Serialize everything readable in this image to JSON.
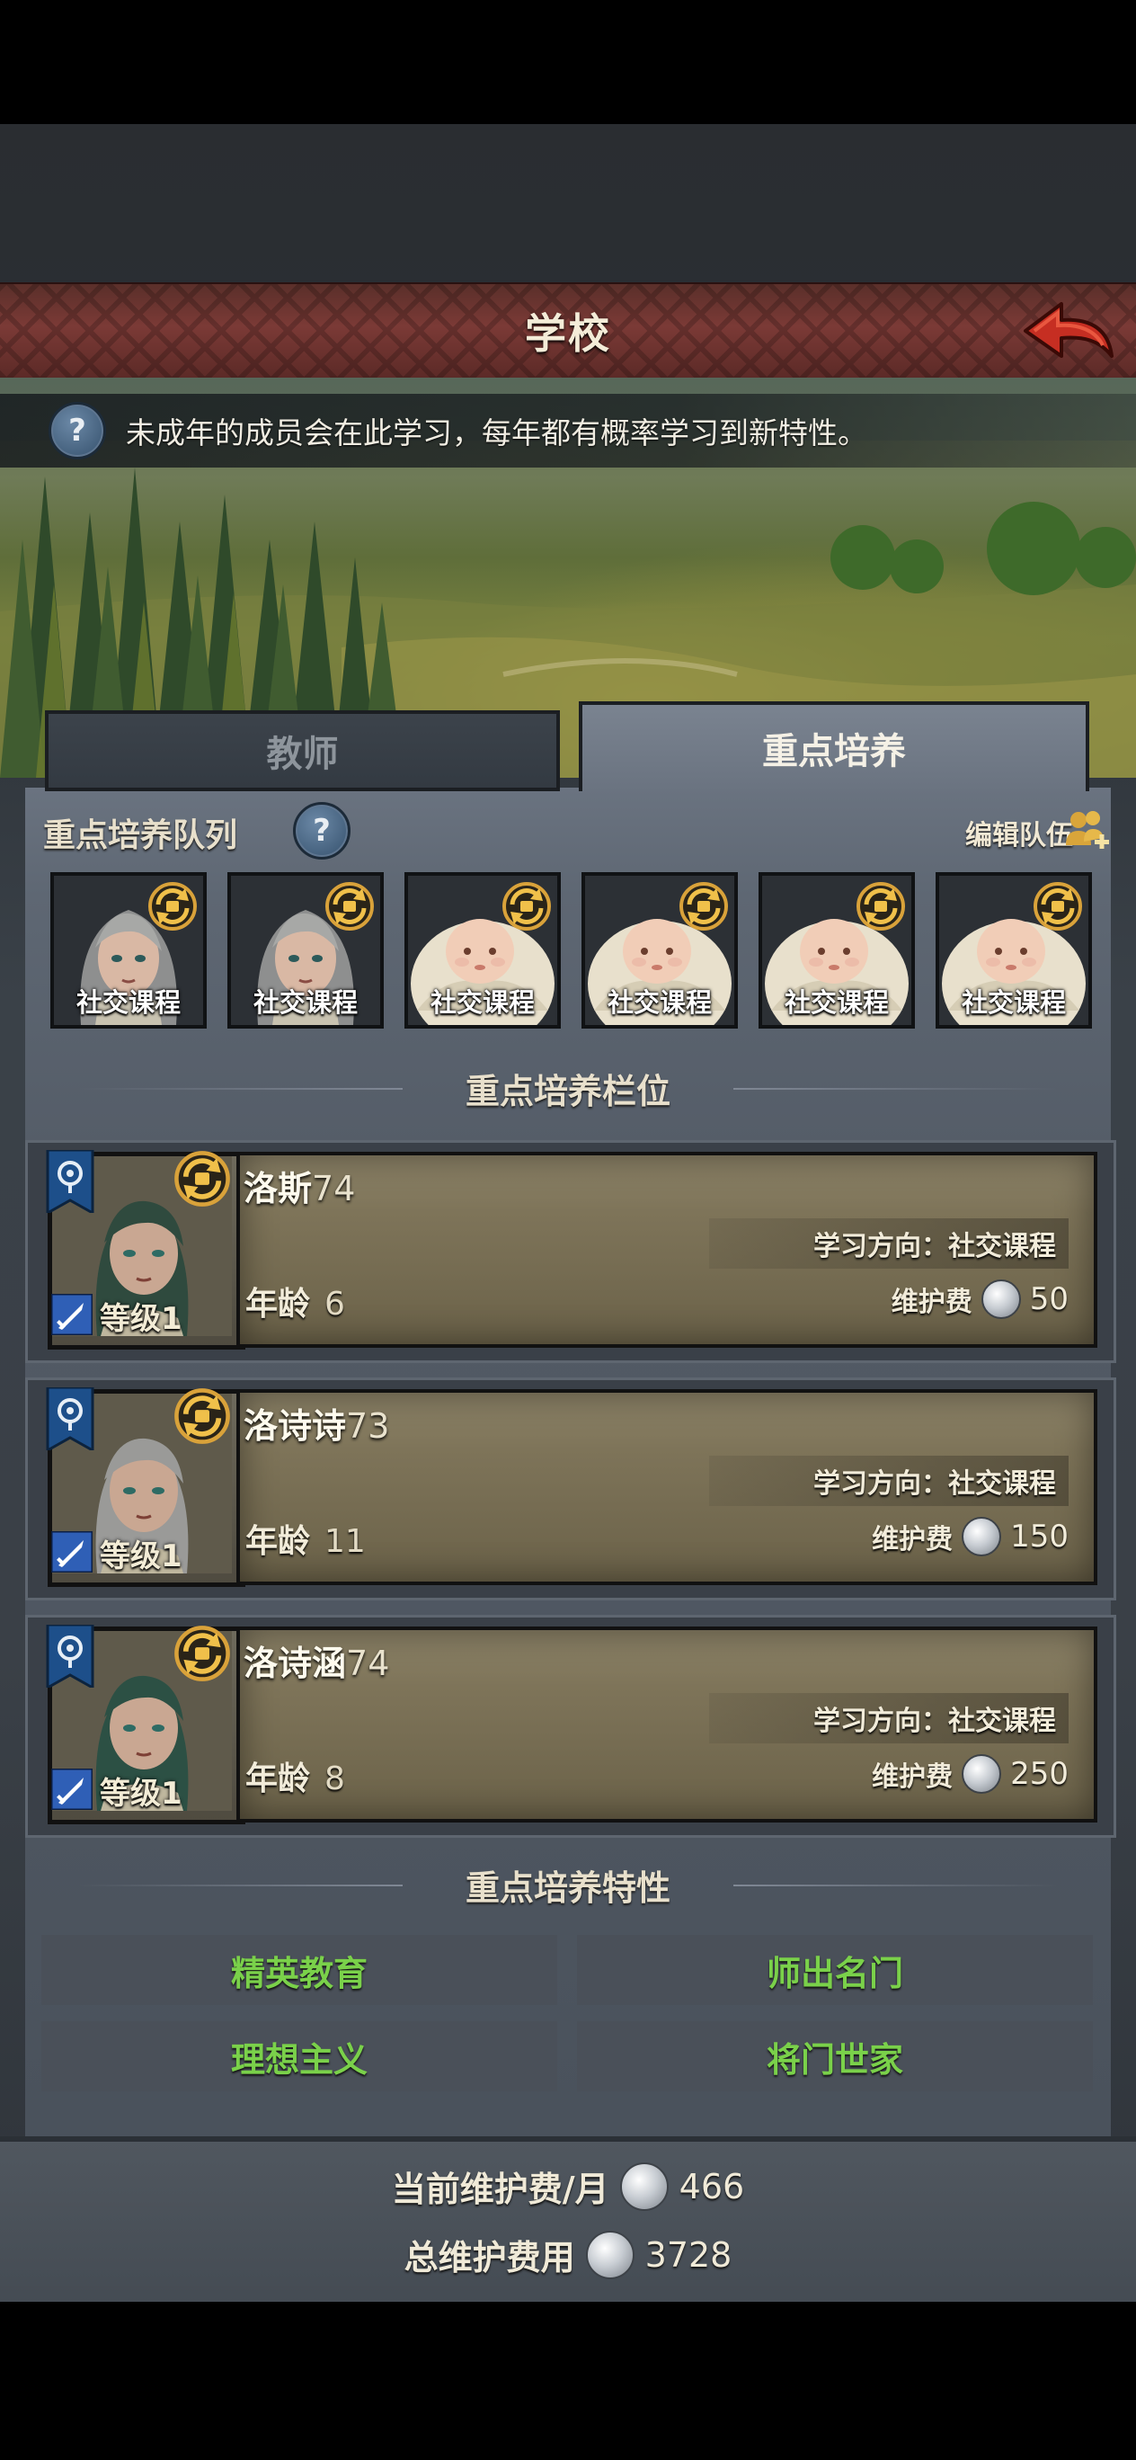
{
  "header": {
    "title": "学校"
  },
  "banner": {
    "info": "未成年的成员会在此学习，每年都有概率学习到新特性。"
  },
  "tabs": [
    {
      "label": "教师",
      "active": false
    },
    {
      "label": "重点培养",
      "active": true
    }
  ],
  "queue": {
    "title": "重点培养队列",
    "edit_label": "编辑队伍",
    "slots": [
      {
        "label": "社交课程",
        "portrait": "girl-silver-hair"
      },
      {
        "label": "社交课程",
        "portrait": "girl-silver-hair"
      },
      {
        "label": "社交课程",
        "portrait": "baby-swaddled"
      },
      {
        "label": "社交课程",
        "portrait": "baby-swaddled"
      },
      {
        "label": "社交课程",
        "portrait": "baby-swaddled"
      },
      {
        "label": "社交课程",
        "portrait": "baby-swaddled"
      }
    ]
  },
  "focus_slots": {
    "title": "重点培养栏位",
    "members": [
      {
        "name": "洛斯",
        "score": "74",
        "level": "等级1",
        "age_label": "年龄",
        "age": "6",
        "study": "学习方向：社交课程",
        "fee_label": "维护费",
        "fee": "50",
        "hair": "#2f4a3e"
      },
      {
        "name": "洛诗诗",
        "score": "73",
        "level": "等级1",
        "age_label": "年龄",
        "age": "11",
        "study": "学习方向：社交课程",
        "fee_label": "维护费",
        "fee": "150",
        "hair": "#9a9a98"
      },
      {
        "name": "洛诗涵",
        "score": "74",
        "level": "等级1",
        "age_label": "年龄",
        "age": "8",
        "study": "学习方向：社交课程",
        "fee_label": "维护费",
        "fee": "250",
        "hair": "#2c5044"
      }
    ]
  },
  "traits": {
    "title": "重点培养特性",
    "items": [
      "精英教育",
      "师出名门",
      "理想主义",
      "将门世家"
    ]
  },
  "footer": {
    "monthly_label": "当前维护费/月",
    "monthly_value": "466",
    "total_label": "总维护费用",
    "total_value": "3728"
  },
  "colors": {
    "trait_green": "#7ad14a",
    "title_bar": "#7b3a36"
  }
}
